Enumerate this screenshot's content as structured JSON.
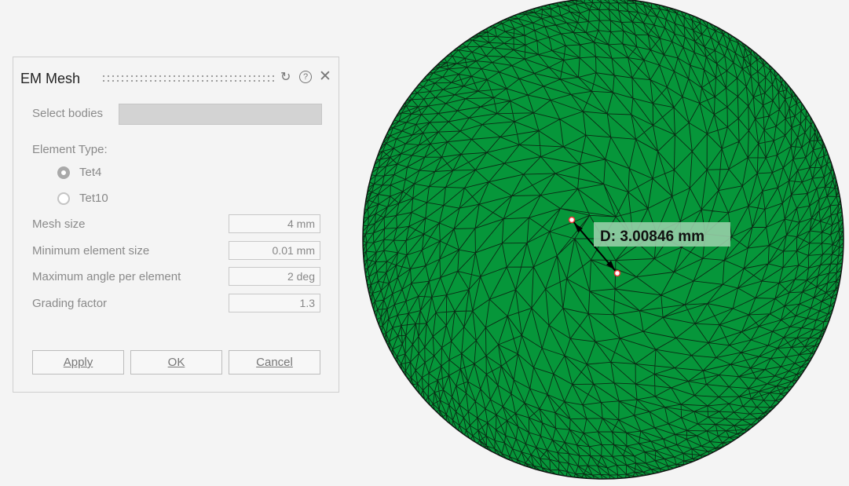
{
  "dialog": {
    "title": "EM Mesh",
    "icons": [
      "reset-icon",
      "help-icon",
      "close-icon"
    ],
    "select_bodies_label": "Select bodies",
    "element_type_label": "Element Type:",
    "element_types": [
      {
        "label": "Tet4",
        "selected": true
      },
      {
        "label": "Tet10",
        "selected": false
      }
    ],
    "fields": [
      {
        "label": "Mesh size",
        "value": "4 mm"
      },
      {
        "label": "Minimum element size",
        "value": "0.01 mm"
      },
      {
        "label": "Maximum angle per element",
        "value": "2 deg"
      },
      {
        "label": "Grading factor",
        "value": "1.3"
      }
    ],
    "buttons": {
      "apply": "Apply",
      "ok": "OK",
      "cancel": "Cancel"
    }
  },
  "viewport": {
    "measurement": "D: 3.00846 mm",
    "mesh_color": "#06963a"
  }
}
